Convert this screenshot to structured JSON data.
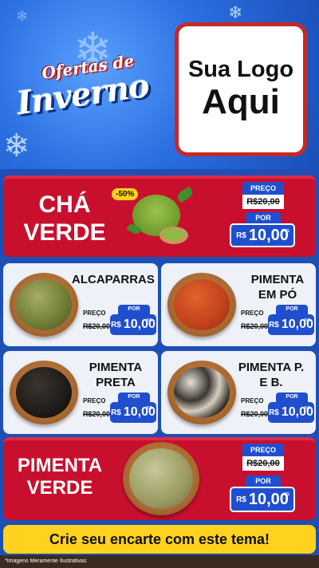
{
  "header": {
    "script_title": "Ofertas de",
    "big_title": "Inverno",
    "logo_line1": "Sua Logo",
    "logo_line2": "Aqui"
  },
  "featured_top": {
    "name_line1": "CHÁ",
    "name_line2": "VERDE",
    "discount": "-50%",
    "preco_label": "PREÇO",
    "old_price": "R$20,00",
    "por_label": "POR",
    "currency": "R$",
    "price": "10,00",
    "unit": "KG"
  },
  "products": [
    {
      "name": "ALCAPARRAS",
      "preco_label": "PREÇO",
      "old_price": "R$20,00",
      "por_label": "POR",
      "currency": "R$",
      "price": "10,00",
      "unit": "KG"
    },
    {
      "name": "PIMENTA EM PÓ",
      "preco_label": "PREÇO",
      "old_price": "R$20,00",
      "por_label": "POR",
      "currency": "R$",
      "price": "10,00",
      "unit": "KG"
    },
    {
      "name": "PIMENTA PRETA",
      "preco_label": "PREÇO",
      "old_price": "R$20,00",
      "por_label": "POR",
      "currency": "R$",
      "price": "10,00",
      "unit": "KG"
    },
    {
      "name": "PIMENTA P. E B.",
      "preco_label": "PREÇO",
      "old_price": "R$20,00",
      "por_label": "POR",
      "currency": "R$",
      "price": "10,00",
      "unit": "KG"
    }
  ],
  "featured_bottom": {
    "name_line1": "PIMENTA",
    "name_line2": "VERDE",
    "preco_label": "PREÇO",
    "old_price": "R$20,00",
    "por_label": "POR",
    "currency": "R$",
    "price": "10,00",
    "unit": "KG"
  },
  "footer": {
    "cta": "Crie seu encarte com este tema!",
    "disclaimer": "*Imagens Meramente Ilustrativas"
  },
  "colors": {
    "header_blue": "#2a6ee0",
    "red": "#c8102e",
    "price_blue": "#1f4fcf",
    "cta_yellow": "#ffd21f"
  }
}
